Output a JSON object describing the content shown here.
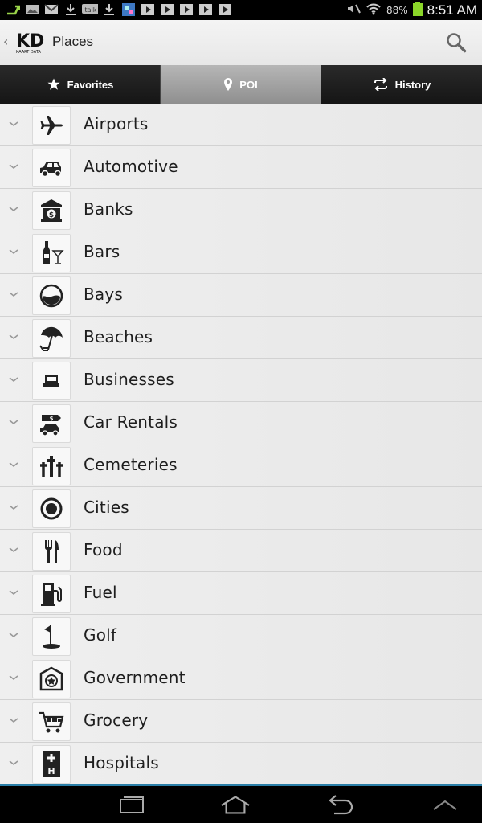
{
  "status_bar": {
    "battery_percent": "88%",
    "time": "8:51 AM",
    "left_icons": [
      "usb-icon",
      "image-icon",
      "gmail-icon",
      "download-icon",
      "talk-icon",
      "download-icon",
      "gallery-icon",
      "play-icon",
      "play-icon",
      "play-icon",
      "play-icon",
      "play-icon"
    ],
    "talk_text": "talk"
  },
  "action_bar": {
    "title": "Places",
    "logo_text": "KD",
    "logo_subtext": "KAART DATA"
  },
  "tabs": [
    {
      "label": "Favorites",
      "icon": "star-icon",
      "active": false
    },
    {
      "label": "POI",
      "icon": "pin-icon",
      "active": true
    },
    {
      "label": "History",
      "icon": "repeat-icon",
      "active": false
    }
  ],
  "categories": [
    {
      "label": "Airports",
      "icon": "airplane-icon"
    },
    {
      "label": "Automotive",
      "icon": "car-icon"
    },
    {
      "label": "Banks",
      "icon": "bank-icon"
    },
    {
      "label": "Bars",
      "icon": "bar-icon"
    },
    {
      "label": "Bays",
      "icon": "bay-icon"
    },
    {
      "label": "Beaches",
      "icon": "umbrella-icon"
    },
    {
      "label": "Businesses",
      "icon": "office-icon"
    },
    {
      "label": "Car Rentals",
      "icon": "car-rental-icon"
    },
    {
      "label": "Cemeteries",
      "icon": "cemetery-icon"
    },
    {
      "label": "Cities",
      "icon": "city-icon"
    },
    {
      "label": "Food",
      "icon": "fork-knife-icon"
    },
    {
      "label": "Fuel",
      "icon": "fuel-pump-icon"
    },
    {
      "label": "Golf",
      "icon": "golf-flag-icon"
    },
    {
      "label": "Government",
      "icon": "government-badge-icon"
    },
    {
      "label": "Grocery",
      "icon": "shopping-cart-icon"
    },
    {
      "label": "Hospitals",
      "icon": "hospital-icon"
    }
  ],
  "colors": {
    "accent_line": "#2b7fa8",
    "battery": "#8bd629"
  }
}
